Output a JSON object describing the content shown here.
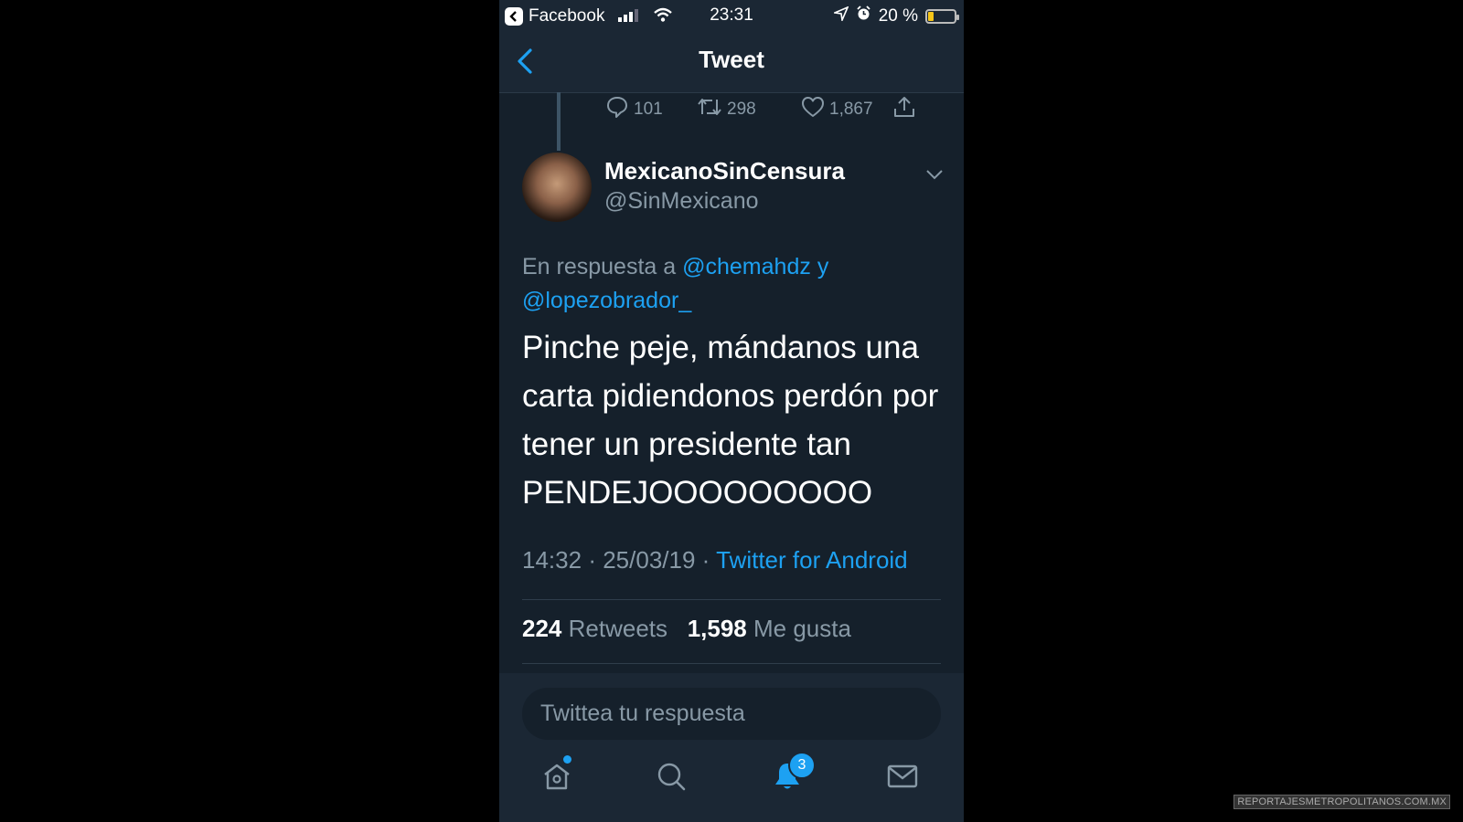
{
  "status_bar": {
    "back_app": "Facebook",
    "time": "23:31",
    "battery": "20 %"
  },
  "nav": {
    "title": "Tweet"
  },
  "previous_tweet_actions": {
    "replies": "101",
    "retweets": "298",
    "likes": "1,867"
  },
  "tweet": {
    "author_name": "MexicanoSinCensura",
    "author_handle": "@SinMexicano",
    "reply_prefix": "En respuesta a",
    "reply_mention_1": "@chemahdz",
    "reply_conj": "y",
    "reply_mention_2": "@lopezobrador_",
    "text": "Pinche peje, mándanos una carta pidiendonos perdón por tener un presidente tan PENDEJOOOOOOOOO",
    "time": "14:32",
    "date": "25/03/19",
    "separator": "·",
    "source": "Twitter for Android",
    "retweets_count": "224",
    "retweets_label": "Retweets",
    "likes_count": "1,598",
    "likes_label": "Me gusta"
  },
  "reply_box": {
    "placeholder": "Twittea tu respuesta"
  },
  "tabbar": {
    "notifications_badge": "3"
  },
  "colors": {
    "background": "#15202b",
    "bar": "#1b2734",
    "accent": "#1da1f2",
    "muted": "#8899a6"
  },
  "watermark": "REPORTAJESMETROPOLITANOS.COM.MX"
}
